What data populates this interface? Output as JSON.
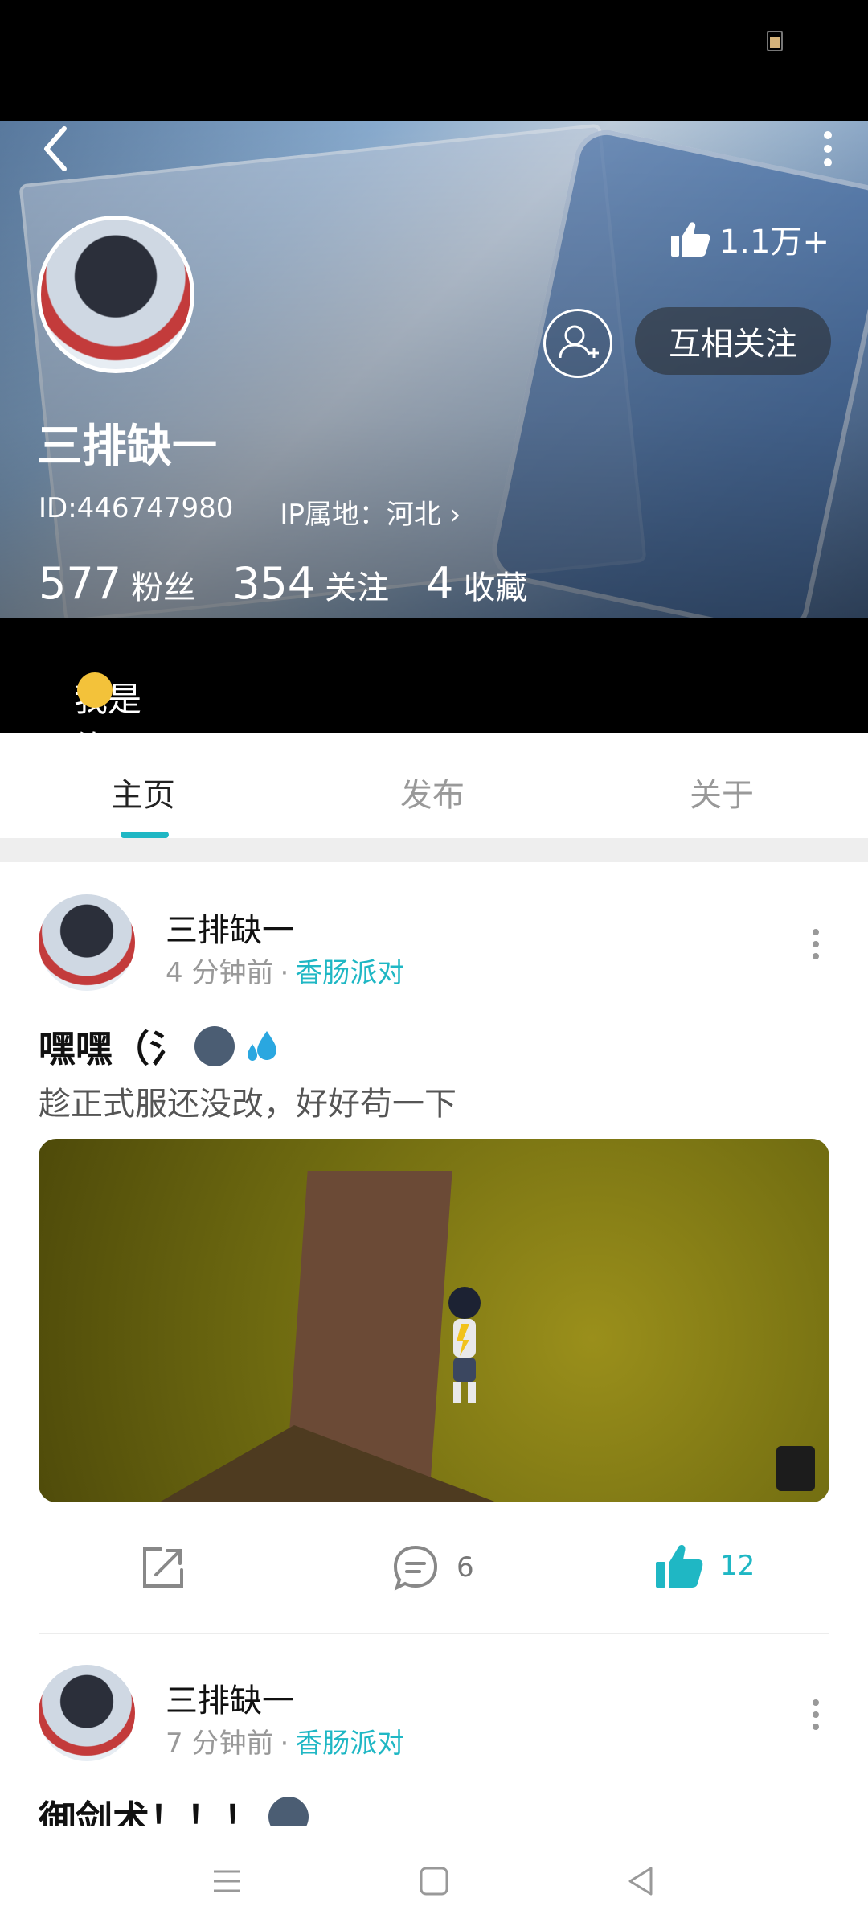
{
  "header": {
    "likes_count": "1.1万+",
    "mutual_follow_label": "互相关注",
    "username": "三排缺一",
    "id_text": "ID:446747980",
    "ip_text": "IP属地：河北 ›",
    "stats": {
      "fans_count": "577",
      "fans_label": "粉丝",
      "following_count": "354",
      "following_label": "关注",
      "favorites_count": "4",
      "favorites_label": "收藏"
    },
    "bio": "我是练习时长两年半的三排缺（）ikun（"
  },
  "tabs": [
    {
      "label": "主页"
    },
    {
      "label": "发布"
    },
    {
      "label": "关于"
    }
  ],
  "posts": [
    {
      "author": "三排缺一",
      "time": "4 分钟前",
      "dot": "·",
      "channel": "香肠派对",
      "title": "嘿嘿（氵",
      "text": "趁正式服还没改，好好苟一下",
      "actions": {
        "comments": "6",
        "likes": "12"
      }
    },
    {
      "author": "三排缺一",
      "time": "7 分钟前",
      "dot": "·",
      "channel": "香肠派对",
      "title": "御剑术！！！"
    }
  ],
  "colors": {
    "accent": "#1fb7c4"
  }
}
